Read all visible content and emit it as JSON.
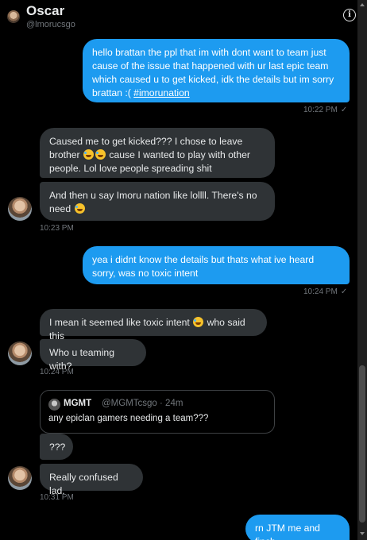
{
  "header": {
    "name": "Oscar",
    "handle": "@lmorucsgo",
    "info_icon": "i"
  },
  "messages": [
    {
      "side": "out",
      "text": "hello brattan the ppl that im with dont want to team just cause of the issue that happened with ur last epic team which caused u to get kicked, idk the details but im sorry brattan :(",
      "link": "#imorunation",
      "time": "10:22 PM"
    },
    {
      "side": "in",
      "text_a": "Caused me to get kicked??? I chose to leave brother",
      "text_b": "cause I wanted to play with other people. Lol love people spreading shit"
    },
    {
      "side": "in",
      "text_a": "And then u say Imoru nation like lollll. There's no need",
      "time": "10:23 PM"
    },
    {
      "side": "out",
      "text": "yea i didnt know the details but thats what ive heard sorry, was no toxic intent",
      "time": "10:24 PM"
    },
    {
      "side": "in",
      "text_a": "I mean it seemed like toxic intent",
      "text_b": "who said this"
    },
    {
      "side": "in",
      "text_a": "Who u teaming with?",
      "time": "10:24 PM"
    },
    {
      "side": "in",
      "quote": {
        "name": "MGMT",
        "handle": "@MGMTcsgo",
        "age": "· 24m",
        "text": "any epiclan gamers needing a team???"
      }
    },
    {
      "side": "in",
      "text_a": "???"
    },
    {
      "side": "in",
      "text_a": "Really confused lad.",
      "time": "10:31 PM"
    },
    {
      "side": "out",
      "text": "rn JTM me and finch"
    }
  ],
  "read_check": "✓",
  "colors": {
    "accent": "#1d9bf0",
    "incoming_bubble": "#2f3336",
    "background": "#000000",
    "muted": "#71767b"
  }
}
